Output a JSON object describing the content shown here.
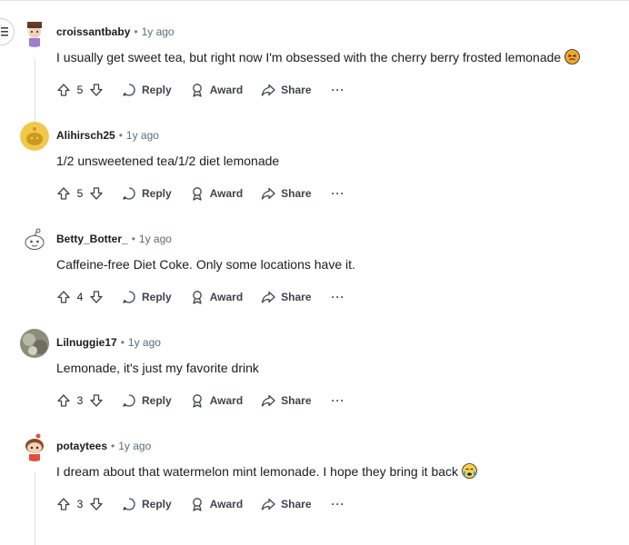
{
  "colors": {
    "text": "#1c1c1c",
    "muted": "#576f76",
    "icon": "#3c4549"
  },
  "actions": {
    "reply": "Reply",
    "award": "Award",
    "share": "Share",
    "more": "···"
  },
  "comments": [
    {
      "author": "croissantbaby",
      "time": "1y ago",
      "text": "I usually get sweet tea, but right now I'm obsessed with the cherry berry frosted lemonade",
      "emoji": "persevering-face-emoji",
      "votes": "5",
      "avatar": "croissant-avatar"
    },
    {
      "author": "Alihirsch25",
      "time": "1y ago",
      "text": "1/2 unsweetened tea/1/2 diet lemonade",
      "votes": "5",
      "avatar": "snoo-yellow-avatar"
    },
    {
      "author": "Betty_Botter_",
      "time": "1y ago",
      "text": "Caffeine-free Diet Coke. Only some locations have it.",
      "votes": "4",
      "avatar": "snoo-white-avatar"
    },
    {
      "author": "Lilnuggie17",
      "time": "1y ago",
      "text": "Lemonade, it's just my favorite drink",
      "votes": "3",
      "avatar": "photo-avatar"
    },
    {
      "author": "potaytees",
      "time": "1y ago",
      "text": "I dream about that watermelon mint lemonade. I hope they bring it back",
      "emoji": "crying-face-emoji",
      "votes": "3",
      "avatar": "snoo-girl-avatar"
    }
  ]
}
